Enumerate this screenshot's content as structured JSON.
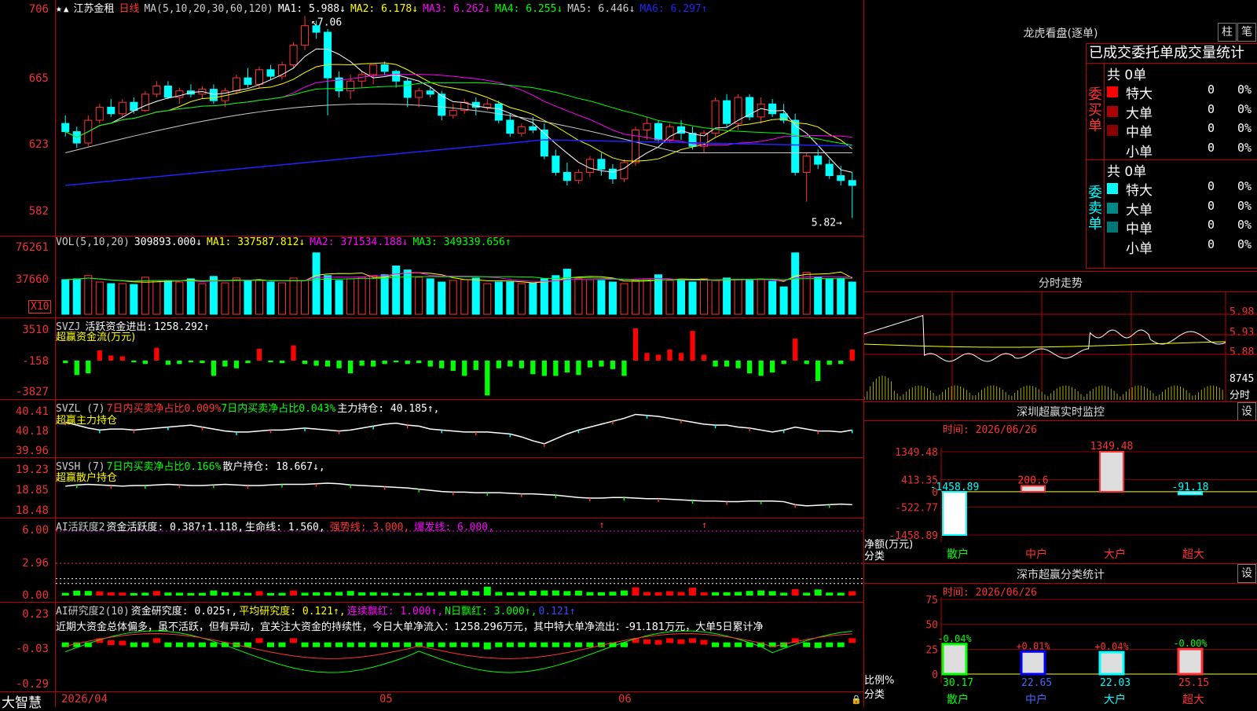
{
  "app": {
    "brand": "大智慧",
    "stock_name": "江苏金租",
    "period": "日线"
  },
  "candle_panel": {
    "ma_header": "MA(5,10,20,30,60,120)",
    "ma_items": [
      {
        "label": "MA1:",
        "value": "5.988↓",
        "color": "#ffffff"
      },
      {
        "label": "MA2:",
        "value": "6.178↓",
        "color": "#ffff00"
      },
      {
        "label": "MA3:",
        "value": "6.262↓",
        "color": "#ff00ff"
      },
      {
        "label": "MA4:",
        "value": "6.255↓",
        "color": "#00ff00"
      },
      {
        "label": "MA5:",
        "value": "6.446↓",
        "color": "#cccccc"
      },
      {
        "label": "MA6:",
        "value": "6.297↑",
        "color": "#2222ff"
      }
    ],
    "y_labels": [
      "706",
      "665",
      "623",
      "582"
    ],
    "high_mark": "7.06",
    "low_mark": "5.82"
  },
  "vol_panel": {
    "title": "VOL(5,10,20)",
    "value": "309893.000↓",
    "items": [
      {
        "label": "MA1:",
        "value": "337587.812↓",
        "color": "#ffff00"
      },
      {
        "label": "MA2:",
        "value": "371534.188↓",
        "color": "#ff00ff"
      },
      {
        "label": "MA3:",
        "value": "349339.656↑",
        "color": "#00ff00"
      }
    ],
    "y_labels": [
      "76261",
      "37660"
    ],
    "unit": "X10"
  },
  "svzj_panel": {
    "title": "SVZJ",
    "label": "活跃资金进出:",
    "value": "1258.292↑",
    "subtitle": "超赢资金流(万元)",
    "y_labels": [
      "3510",
      "-158",
      "-3827"
    ]
  },
  "svzl_panel": {
    "title": "SVZL (7)",
    "t1": "7日内买卖净占比0.009%",
    "t2": "7日内买卖净占比0.043%",
    "t3": "主力持仓: 40.185↑,",
    "subtitle": "超赢主力持仓",
    "y_labels": [
      "40.41",
      "40.18",
      "39.96"
    ]
  },
  "svsh_panel": {
    "title": "SVSH (7)",
    "t1": "7日内买卖净占比0.166%",
    "t2": "散户持仓: 18.667↓,",
    "subtitle": "超赢散户持仓",
    "y_labels": [
      "19.23",
      "18.85",
      "18.48"
    ]
  },
  "ai_active_panel": {
    "title": "AI活跃度2",
    "t1": "资金活跃度: 0.387↑",
    "t2": "1.118,",
    "t3": "生命线: 1.560,",
    "t4": "强势线: 3.000,",
    "t5": "爆发线: 6.000,",
    "y_labels": [
      "6.00",
      "2.96",
      "0.00"
    ]
  },
  "ai_research_panel": {
    "title": "AI研究度2(10)",
    "t1": "资金研究度: 0.025↑,",
    "t2": "平均研究度: 0.121↑,",
    "t3": "连续飘红: 1.000↑,",
    "t4": "N日飘红: 3.000↑,",
    "t5": "0.121↑",
    "comment": "近期大资金总体偏多，虽不活跃，但有异动，宜关注大资金的持续性，今日大单净流入：1258.296万元，其中特大单净流出：-91.181万元，大单5日累计净",
    "y_labels": [
      "0.23",
      "-0.03",
      "-0.29"
    ]
  },
  "x_axis": {
    "labels": [
      "2026/04",
      "05",
      "06"
    ]
  },
  "dragon": {
    "title": "龙虎看盘(逐单)",
    "btn_bar": "柱",
    "btn_pen": "笔",
    "header": "已成交委托单成交量统计",
    "buy_side_label": "委买单",
    "sell_side_label": "委卖单",
    "buy_total": "共 0单",
    "sell_total": "共 0单",
    "buy_rows": [
      {
        "name": "特大",
        "count": "0",
        "pct": "0%"
      },
      {
        "name": "大单",
        "count": "0",
        "pct": "0%"
      },
      {
        "name": "中单",
        "count": "0",
        "pct": "0%"
      },
      {
        "name": "小单",
        "count": "0",
        "pct": "0%"
      }
    ],
    "sell_rows": [
      {
        "name": "特大",
        "count": "0",
        "pct": "0%"
      },
      {
        "name": "大单",
        "count": "0",
        "pct": "0%"
      },
      {
        "name": "中单",
        "count": "0",
        "pct": "0%"
      },
      {
        "name": "小单",
        "count": "0",
        "pct": "0%"
      }
    ],
    "buy_colors": [
      "#ff0000",
      "#aa0000",
      "#880000",
      "#000000"
    ],
    "sell_colors": [
      "#00ffff",
      "#008888",
      "#007777",
      "#000000"
    ]
  },
  "intraday": {
    "title": "分时走势",
    "y_labels": [
      "5.98",
      "5.93",
      "5.88"
    ],
    "vol_label": "8745",
    "unit": "分时"
  },
  "sz_monitor": {
    "title": "深圳超赢实时监控",
    "btn": "设",
    "time": "时间: 2026/06/26",
    "y_labels": [
      "1349.48",
      "413.35",
      "0",
      "-522.77",
      "-1458.89"
    ],
    "unit1": "净额(万元)",
    "unit2": "分类",
    "categories": [
      "散户",
      "中户",
      "大户",
      "超大"
    ],
    "values": [
      -1458.89,
      200.6,
      1349.48,
      -91.18
    ],
    "value_labels": [
      "-1458.89",
      "200.6",
      "1349.48",
      "-91.18"
    ]
  },
  "sz_classify": {
    "title": "深市超赢分类统计",
    "btn": "设",
    "time": "时间: 2026/06/26",
    "y_labels": [
      "75",
      "50",
      "25",
      "0"
    ],
    "unit1": "比例%",
    "unit2": "分类",
    "categories": [
      "散户",
      "中户",
      "大户",
      "超大"
    ],
    "values": [
      30.17,
      22.65,
      22.03,
      25.15
    ],
    "changes": [
      "-0.04%",
      "+0.01%",
      "+0.04%",
      "-0.00%"
    ],
    "cat_colors": [
      "#00ff00",
      "#0000ff",
      "#00ffff",
      "#ff3333"
    ]
  },
  "chart_data": {
    "type": "bar",
    "title": "江苏金租 日线",
    "x_labels": [
      "2026/04",
      "05",
      "06"
    ],
    "candles_ohlc": [
      [
        6.4,
        6.45,
        6.32,
        6.35
      ],
      [
        6.35,
        6.38,
        6.25,
        6.28
      ],
      [
        6.28,
        6.45,
        6.26,
        6.42
      ],
      [
        6.42,
        6.52,
        6.4,
        6.5
      ],
      [
        6.5,
        6.55,
        6.44,
        6.46
      ],
      [
        6.46,
        6.55,
        6.44,
        6.53
      ],
      [
        6.53,
        6.56,
        6.46,
        6.48
      ],
      [
        6.48,
        6.6,
        6.47,
        6.58
      ],
      [
        6.58,
        6.66,
        6.56,
        6.63
      ],
      [
        6.63,
        6.66,
        6.55,
        6.56
      ],
      [
        6.56,
        6.62,
        6.52,
        6.6
      ],
      [
        6.6,
        6.64,
        6.56,
        6.58
      ],
      [
        6.58,
        6.63,
        6.55,
        6.61
      ],
      [
        6.61,
        6.64,
        6.52,
        6.54
      ],
      [
        6.54,
        6.62,
        6.5,
        6.6
      ],
      [
        6.6,
        6.7,
        6.58,
        6.68
      ],
      [
        6.68,
        6.74,
        6.62,
        6.64
      ],
      [
        6.64,
        6.75,
        6.62,
        6.73
      ],
      [
        6.73,
        6.76,
        6.67,
        6.69
      ],
      [
        6.69,
        6.78,
        6.67,
        6.76
      ],
      [
        6.76,
        6.9,
        6.74,
        6.88
      ],
      [
        6.88,
        7.06,
        6.85,
        7.0
      ],
      [
        7.0,
        7.03,
        6.92,
        6.96
      ],
      [
        6.96,
        6.98,
        6.45,
        6.68
      ],
      [
        6.68,
        6.72,
        6.56,
        6.6
      ],
      [
        6.6,
        6.7,
        6.55,
        6.66
      ],
      [
        6.66,
        6.72,
        6.62,
        6.7
      ],
      [
        6.7,
        6.74,
        6.64,
        6.76
      ],
      [
        6.76,
        6.78,
        6.7,
        6.72
      ],
      [
        6.72,
        6.73,
        6.62,
        6.66
      ],
      [
        6.66,
        6.68,
        6.5,
        6.56
      ],
      [
        6.56,
        6.62,
        6.5,
        6.6
      ],
      [
        6.6,
        6.63,
        6.56,
        6.58
      ],
      [
        6.58,
        6.6,
        6.42,
        6.45
      ],
      [
        6.45,
        6.52,
        6.43,
        6.48
      ],
      [
        6.48,
        6.55,
        6.46,
        6.53
      ],
      [
        6.53,
        6.56,
        6.45,
        6.5
      ],
      [
        6.5,
        6.55,
        6.48,
        6.52
      ],
      [
        6.52,
        6.54,
        6.4,
        6.42
      ],
      [
        6.42,
        6.46,
        6.32,
        6.34
      ],
      [
        6.34,
        6.4,
        6.32,
        6.38
      ],
      [
        6.38,
        6.44,
        6.34,
        6.36
      ],
      [
        6.36,
        6.4,
        6.18,
        6.2
      ],
      [
        6.2,
        6.24,
        6.08,
        6.1
      ],
      [
        6.1,
        6.16,
        6.02,
        6.05
      ],
      [
        6.05,
        6.12,
        6.03,
        6.1
      ],
      [
        6.1,
        6.2,
        6.07,
        6.18
      ],
      [
        6.18,
        6.22,
        6.08,
        6.12
      ],
      [
        6.12,
        6.15,
        6.03,
        6.06
      ],
      [
        6.06,
        6.18,
        6.04,
        6.16
      ],
      [
        6.16,
        6.38,
        6.14,
        6.36
      ],
      [
        6.36,
        6.44,
        6.3,
        6.4
      ],
      [
        6.4,
        6.42,
        6.28,
        6.3
      ],
      [
        6.3,
        6.4,
        6.28,
        6.38
      ],
      [
        6.38,
        6.42,
        6.3,
        6.34
      ],
      [
        6.34,
        6.38,
        6.24,
        6.26
      ],
      [
        6.26,
        6.36,
        6.22,
        6.34
      ],
      [
        6.34,
        6.56,
        6.32,
        6.54
      ],
      [
        6.54,
        6.58,
        6.38,
        6.4
      ],
      [
        6.4,
        6.58,
        6.36,
        6.56
      ],
      [
        6.56,
        6.58,
        6.42,
        6.44
      ],
      [
        6.44,
        6.56,
        6.4,
        6.52
      ],
      [
        6.52,
        6.55,
        6.44,
        6.46
      ],
      [
        6.46,
        6.52,
        6.4,
        6.42
      ],
      [
        6.42,
        6.46,
        6.08,
        6.1
      ],
      [
        6.1,
        6.22,
        5.92,
        6.2
      ],
      [
        6.2,
        6.24,
        6.12,
        6.15
      ],
      [
        6.15,
        6.18,
        6.06,
        6.08
      ],
      [
        6.08,
        6.14,
        6.02,
        6.05
      ],
      [
        6.05,
        6.1,
        5.82,
        6.02
      ]
    ],
    "volume_x10": [
      43000,
      44000,
      48000,
      40000,
      38000,
      38000,
      37000,
      46000,
      42000,
      42000,
      40000,
      44000,
      38000,
      47000,
      39000,
      45000,
      42000,
      42000,
      40000,
      39000,
      45000,
      42000,
      76261,
      48000,
      42000,
      44000,
      46000,
      48000,
      49000,
      60000,
      55000,
      46000,
      44000,
      40000,
      42000,
      43000,
      45000,
      38000,
      40000,
      40000,
      38000,
      39000,
      44000,
      48000,
      56000,
      44000,
      43000,
      42000,
      40000,
      38000,
      42000,
      44000,
      49000,
      42000,
      42000,
      40000,
      44000,
      42000,
      45000,
      43000,
      42000,
      44000,
      41000,
      34000,
      76261,
      52000,
      46000,
      44000,
      44000,
      40000
    ],
    "svzj_wan": [
      -300,
      -1700,
      -1500,
      1200,
      600,
      500,
      -200,
      -400,
      1500,
      -500,
      -400,
      -200,
      -300,
      -1800,
      -700,
      -900,
      -300,
      1400,
      -200,
      -300,
      1800,
      -400,
      -600,
      -700,
      -900,
      -1500,
      -600,
      -700,
      -400,
      -200,
      -400,
      -300,
      -700,
      -900,
      -1200,
      -1800,
      -1100,
      -4100,
      -900,
      -700,
      -900,
      -1600,
      -1800,
      -1800,
      -1400,
      -1700,
      -800,
      -700,
      -1000,
      -1800,
      3800,
      900,
      700,
      1300,
      900,
      3500,
      700,
      -700,
      -700,
      -900,
      -1500,
      -1800,
      -1400,
      -400,
      2600,
      -400,
      -2400,
      -500,
      -400,
      1300
    ],
    "svzl": [
      40.27,
      40.24,
      40.21,
      40.19,
      40.2,
      40.2,
      40.19,
      40.2,
      40.21,
      40.22,
      40.23,
      40.24,
      40.22,
      40.2,
      40.18,
      40.17,
      40.17,
      40.18,
      40.19,
      40.19,
      40.2,
      40.21,
      40.2,
      40.19,
      40.18,
      40.19,
      40.21,
      40.23,
      40.25,
      40.26,
      40.24,
      40.23,
      40.2,
      40.19,
      40.18,
      40.17,
      40.17,
      40.17,
      40.16,
      40.15,
      40.12,
      40.08,
      40.05,
      40.1,
      40.15,
      40.19,
      40.22,
      40.25,
      40.28,
      40.31,
      40.35,
      40.34,
      40.33,
      40.31,
      40.29,
      40.27,
      40.25,
      40.24,
      40.24,
      40.22,
      40.21,
      40.19,
      40.17,
      40.19,
      40.22,
      40.2,
      40.18,
      40.18,
      40.17,
      40.19
    ],
    "svsh": [
      18.93,
      18.95,
      18.96,
      18.95,
      18.94,
      18.93,
      18.94,
      18.94,
      18.95,
      18.96,
      18.95,
      18.94,
      18.94,
      18.95,
      18.96,
      18.95,
      18.94,
      18.94,
      18.95,
      18.96,
      18.96,
      18.96,
      18.97,
      18.98,
      18.97,
      18.95,
      18.94,
      18.93,
      18.92,
      18.91,
      18.9,
      18.88,
      18.86,
      18.84,
      18.83,
      18.83,
      18.82,
      18.82,
      18.82,
      18.81,
      18.8,
      18.8,
      18.79,
      18.78,
      18.76,
      18.74,
      18.73,
      18.73,
      18.74,
      18.74,
      18.73,
      18.72,
      18.72,
      18.71,
      18.7,
      18.69,
      18.68,
      18.68,
      18.67,
      18.67,
      18.68,
      18.68,
      18.68,
      18.67,
      18.62,
      18.6,
      18.61,
      18.62,
      18.63,
      18.62
    ]
  }
}
